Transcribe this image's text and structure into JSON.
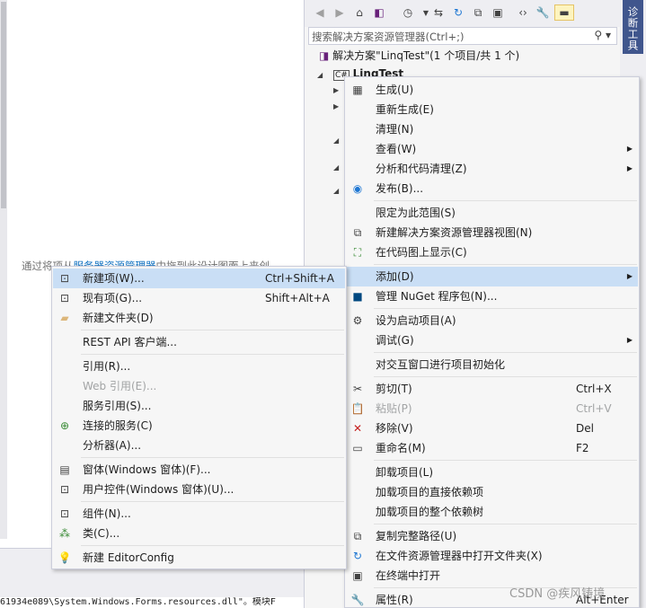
{
  "designer": {
    "hint_text": "通过将项从",
    "hint_link": "服务器资源管理器",
    "hint_rest": "中拖到此设计图面上来创",
    "output_line": "61934e089\\System.Windows.Forms.resources.dll\"。模块F"
  },
  "solution_explorer": {
    "search_placeholder": "搜索解决方案资源管理器(Ctrl+;)",
    "search_icon": "search-icon",
    "solution_label": "解决方案\"LinqTest\"(1 个项目/共 1 个)",
    "project_label": "LinqTest",
    "project_badge": "C#"
  },
  "diagnostics_tab": "诊断工具",
  "main_menu": {
    "items": [
      {
        "label": "生成(U)",
        "icon": "build-icon",
        "shortcut": ""
      },
      {
        "label": "重新生成(E)",
        "icon": "",
        "shortcut": ""
      },
      {
        "label": "清理(N)",
        "icon": "",
        "shortcut": ""
      },
      {
        "label": "查看(W)",
        "icon": "",
        "shortcut": ""
      },
      {
        "label": "分析和代码清理(Z)",
        "icon": "",
        "shortcut": ""
      },
      {
        "label": "发布(B)...",
        "icon": "globe-icon",
        "shortcut": ""
      },
      {
        "label": "限定为此范围(S)",
        "icon": "",
        "shortcut": ""
      },
      {
        "label": "新建解决方案资源管理器视图(N)",
        "icon": "new-view-icon",
        "shortcut": ""
      },
      {
        "label": "在代码图上显示(C)",
        "icon": "code-map-icon",
        "shortcut": ""
      },
      {
        "label": "添加(D)",
        "icon": "",
        "shortcut": ""
      },
      {
        "label": "管理 NuGet 程序包(N)...",
        "icon": "nuget-icon",
        "shortcut": ""
      },
      {
        "label": "设为启动项目(A)",
        "icon": "gear-icon",
        "shortcut": ""
      },
      {
        "label": "调试(G)",
        "icon": "",
        "shortcut": ""
      },
      {
        "label": "对交互窗口进行项目初始化",
        "icon": "",
        "shortcut": ""
      },
      {
        "label": "剪切(T)",
        "icon": "scissors-icon",
        "shortcut": "Ctrl+X"
      },
      {
        "label": "粘贴(P)",
        "icon": "paste-icon",
        "shortcut": "Ctrl+V"
      },
      {
        "label": "移除(V)",
        "icon": "remove-icon",
        "shortcut": "Del"
      },
      {
        "label": "重命名(M)",
        "icon": "rename-icon",
        "shortcut": "F2"
      },
      {
        "label": "卸载项目(L)",
        "icon": "",
        "shortcut": ""
      },
      {
        "label": "加载项目的直接依赖项",
        "icon": "",
        "shortcut": ""
      },
      {
        "label": "加载项目的整个依赖树",
        "icon": "",
        "shortcut": ""
      },
      {
        "label": "复制完整路径(U)",
        "icon": "copy-icon",
        "shortcut": ""
      },
      {
        "label": "在文件资源管理器中打开文件夹(X)",
        "icon": "refresh-arrow-icon",
        "shortcut": ""
      },
      {
        "label": "在终端中打开",
        "icon": "terminal-icon",
        "shortcut": ""
      },
      {
        "label": "属性(R)",
        "icon": "wrench-icon",
        "shortcut": "Alt+Enter"
      }
    ]
  },
  "add_menu": {
    "items": [
      {
        "label": "新建项(W)...",
        "icon": "new-item-icon",
        "shortcut": "Ctrl+Shift+A"
      },
      {
        "label": "现有项(G)...",
        "icon": "existing-item-icon",
        "shortcut": "Shift+Alt+A"
      },
      {
        "label": "新建文件夹(D)",
        "icon": "folder-icon",
        "shortcut": ""
      },
      {
        "label": "REST API 客户端...",
        "icon": "",
        "shortcut": ""
      },
      {
        "label": "引用(R)...",
        "icon": "",
        "shortcut": ""
      },
      {
        "label": "Web 引用(E)...",
        "icon": "",
        "shortcut": ""
      },
      {
        "label": "服务引用(S)...",
        "icon": "",
        "shortcut": ""
      },
      {
        "label": "连接的服务(C)",
        "icon": "connected-service-icon",
        "shortcut": ""
      },
      {
        "label": "分析器(A)...",
        "icon": "",
        "shortcut": ""
      },
      {
        "label": "窗体(Windows 窗体)(F)...",
        "icon": "form-icon",
        "shortcut": ""
      },
      {
        "label": "用户控件(Windows 窗体)(U)...",
        "icon": "user-control-icon",
        "shortcut": ""
      },
      {
        "label": "组件(N)...",
        "icon": "component-icon",
        "shortcut": ""
      },
      {
        "label": "类(C)...",
        "icon": "class-icon",
        "shortcut": ""
      },
      {
        "label": "新建 EditorConfig",
        "icon": "lightbulb-icon",
        "shortcut": ""
      }
    ]
  },
  "watermark": "CSDN @疾风铸境"
}
